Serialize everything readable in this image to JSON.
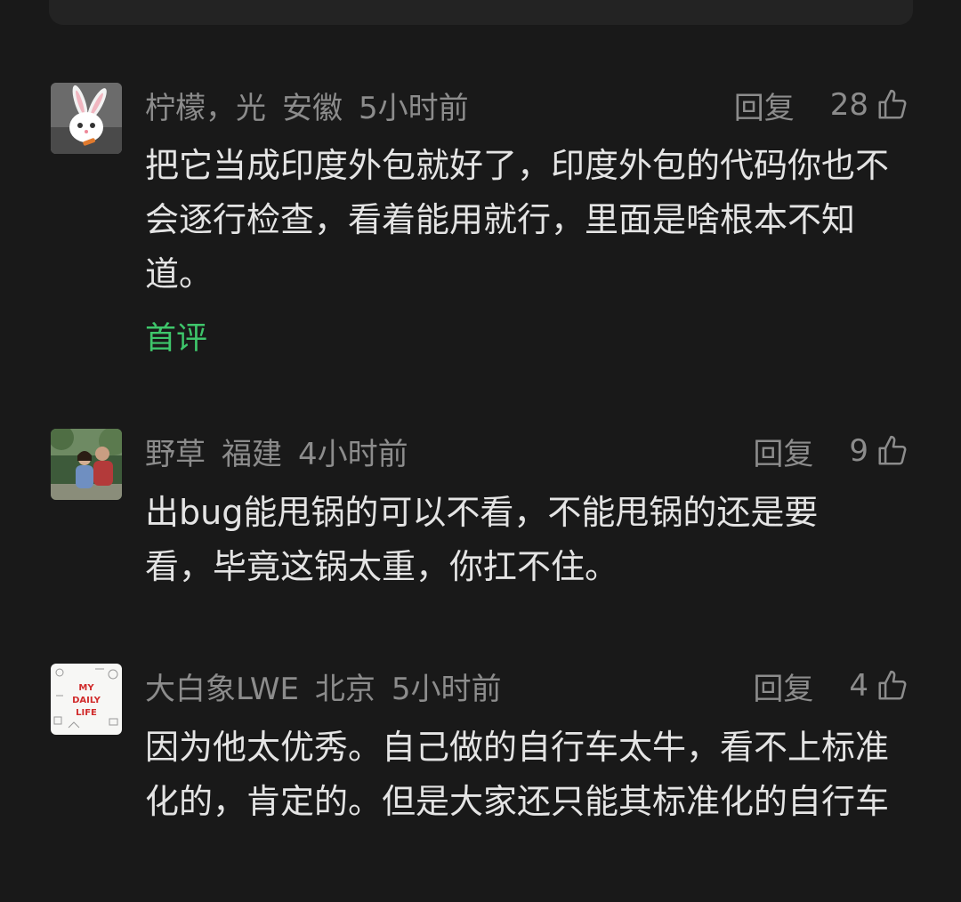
{
  "comments": [
    {
      "username": "柠檬，光",
      "location": "安徽",
      "time": "5小时前",
      "reply_label": "回复",
      "likes": "28",
      "text": "把它当成印度外包就好了，印度外包的代码你也不会逐行检查，看着能用就行，里面是啥根本不知道。",
      "tag": "首评"
    },
    {
      "username": "野草",
      "location": "福建",
      "time": "4小时前",
      "reply_label": "回复",
      "likes": "9",
      "text": "出bug能甩锅的可以不看，不能甩锅的还是要看，毕竟这锅太重，你扛不住。"
    },
    {
      "username": "大白象LWE",
      "location": "北京",
      "time": "5小时前",
      "reply_label": "回复",
      "likes": "4",
      "text": "因为他太优秀。自己做的自行车太牛，看不上标准化的，肯定的。但是大家还只能其标准化的自行车",
      "avatar_text": "MY DAILY LIFE"
    }
  ],
  "colors": {
    "background": "#191919",
    "meta": "#8c8c8c",
    "text": "#e4e4e4",
    "tag": "#3ec66b"
  }
}
